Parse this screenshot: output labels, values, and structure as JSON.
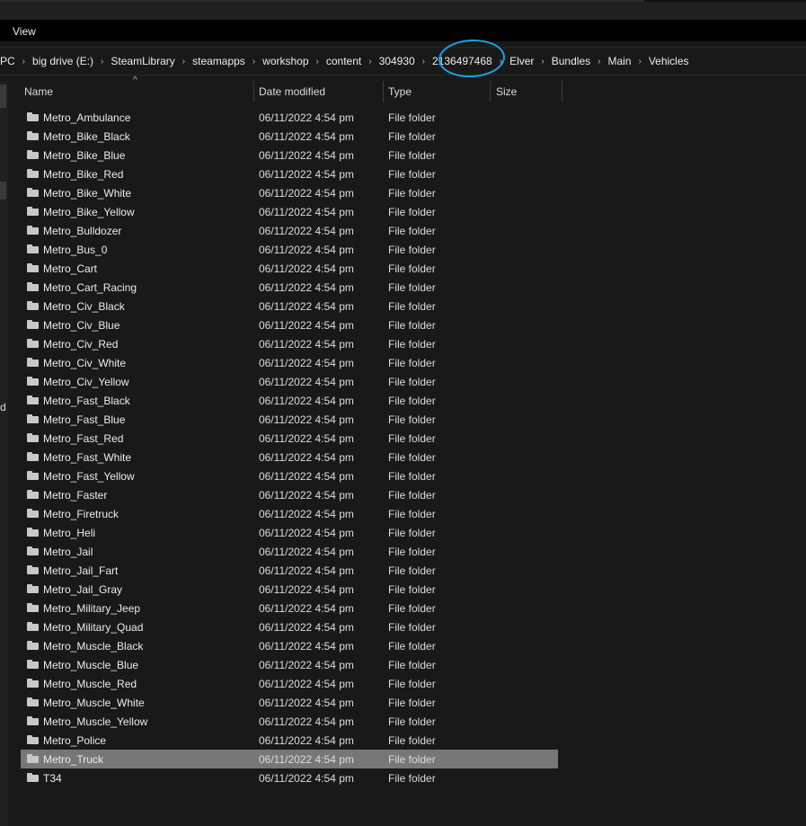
{
  "menu": {
    "view_label": "View"
  },
  "breadcrumb": [
    "PC",
    "big drive (E:)",
    "SteamLibrary",
    "steamapps",
    "workshop",
    "content",
    "304930",
    "2136497468",
    "Elver",
    "Bundles",
    "Main",
    "Vehicles"
  ],
  "breadcrumb_separator": "›",
  "nav_pane": {
    "truncated_letter": "d"
  },
  "columns": {
    "name": "Name",
    "date": "Date modified",
    "type": "Type",
    "size": "Size"
  },
  "sort_indicator": "^",
  "annotation": {
    "color": "#1ba1e2",
    "circled_item": "2136497468"
  },
  "files": [
    {
      "name": "Metro_Ambulance",
      "date": "06/11/2022 4:54 pm",
      "type": "File folder"
    },
    {
      "name": "Metro_Bike_Black",
      "date": "06/11/2022 4:54 pm",
      "type": "File folder"
    },
    {
      "name": "Metro_Bike_Blue",
      "date": "06/11/2022 4:54 pm",
      "type": "File folder"
    },
    {
      "name": "Metro_Bike_Red",
      "date": "06/11/2022 4:54 pm",
      "type": "File folder"
    },
    {
      "name": "Metro_Bike_White",
      "date": "06/11/2022 4:54 pm",
      "type": "File folder"
    },
    {
      "name": "Metro_Bike_Yellow",
      "date": "06/11/2022 4:54 pm",
      "type": "File folder"
    },
    {
      "name": "Metro_Bulldozer",
      "date": "06/11/2022 4:54 pm",
      "type": "File folder"
    },
    {
      "name": "Metro_Bus_0",
      "date": "06/11/2022 4:54 pm",
      "type": "File folder"
    },
    {
      "name": "Metro_Cart",
      "date": "06/11/2022 4:54 pm",
      "type": "File folder"
    },
    {
      "name": "Metro_Cart_Racing",
      "date": "06/11/2022 4:54 pm",
      "type": "File folder"
    },
    {
      "name": "Metro_Civ_Black",
      "date": "06/11/2022 4:54 pm",
      "type": "File folder"
    },
    {
      "name": "Metro_Civ_Blue",
      "date": "06/11/2022 4:54 pm",
      "type": "File folder"
    },
    {
      "name": "Metro_Civ_Red",
      "date": "06/11/2022 4:54 pm",
      "type": "File folder"
    },
    {
      "name": "Metro_Civ_White",
      "date": "06/11/2022 4:54 pm",
      "type": "File folder"
    },
    {
      "name": "Metro_Civ_Yellow",
      "date": "06/11/2022 4:54 pm",
      "type": "File folder"
    },
    {
      "name": "Metro_Fast_Black",
      "date": "06/11/2022 4:54 pm",
      "type": "File folder"
    },
    {
      "name": "Metro_Fast_Blue",
      "date": "06/11/2022 4:54 pm",
      "type": "File folder"
    },
    {
      "name": "Metro_Fast_Red",
      "date": "06/11/2022 4:54 pm",
      "type": "File folder"
    },
    {
      "name": "Metro_Fast_White",
      "date": "06/11/2022 4:54 pm",
      "type": "File folder"
    },
    {
      "name": "Metro_Fast_Yellow",
      "date": "06/11/2022 4:54 pm",
      "type": "File folder"
    },
    {
      "name": "Metro_Faster",
      "date": "06/11/2022 4:54 pm",
      "type": "File folder"
    },
    {
      "name": "Metro_Firetruck",
      "date": "06/11/2022 4:54 pm",
      "type": "File folder"
    },
    {
      "name": "Metro_Heli",
      "date": "06/11/2022 4:54 pm",
      "type": "File folder"
    },
    {
      "name": "Metro_Jail",
      "date": "06/11/2022 4:54 pm",
      "type": "File folder"
    },
    {
      "name": "Metro_Jail_Fart",
      "date": "06/11/2022 4:54 pm",
      "type": "File folder"
    },
    {
      "name": "Metro_Jail_Gray",
      "date": "06/11/2022 4:54 pm",
      "type": "File folder"
    },
    {
      "name": "Metro_Military_Jeep",
      "date": "06/11/2022 4:54 pm",
      "type": "File folder"
    },
    {
      "name": "Metro_Military_Quad",
      "date": "06/11/2022 4:54 pm",
      "type": "File folder"
    },
    {
      "name": "Metro_Muscle_Black",
      "date": "06/11/2022 4:54 pm",
      "type": "File folder"
    },
    {
      "name": "Metro_Muscle_Blue",
      "date": "06/11/2022 4:54 pm",
      "type": "File folder"
    },
    {
      "name": "Metro_Muscle_Red",
      "date": "06/11/2022 4:54 pm",
      "type": "File folder"
    },
    {
      "name": "Metro_Muscle_White",
      "date": "06/11/2022 4:54 pm",
      "type": "File folder"
    },
    {
      "name": "Metro_Muscle_Yellow",
      "date": "06/11/2022 4:54 pm",
      "type": "File folder"
    },
    {
      "name": "Metro_Police",
      "date": "06/11/2022 4:54 pm",
      "type": "File folder"
    },
    {
      "name": "Metro_Truck",
      "date": "06/11/2022 4:54 pm",
      "type": "File folder",
      "selected": true
    },
    {
      "name": "T34",
      "date": "06/11/2022 4:54 pm",
      "type": "File folder"
    }
  ]
}
